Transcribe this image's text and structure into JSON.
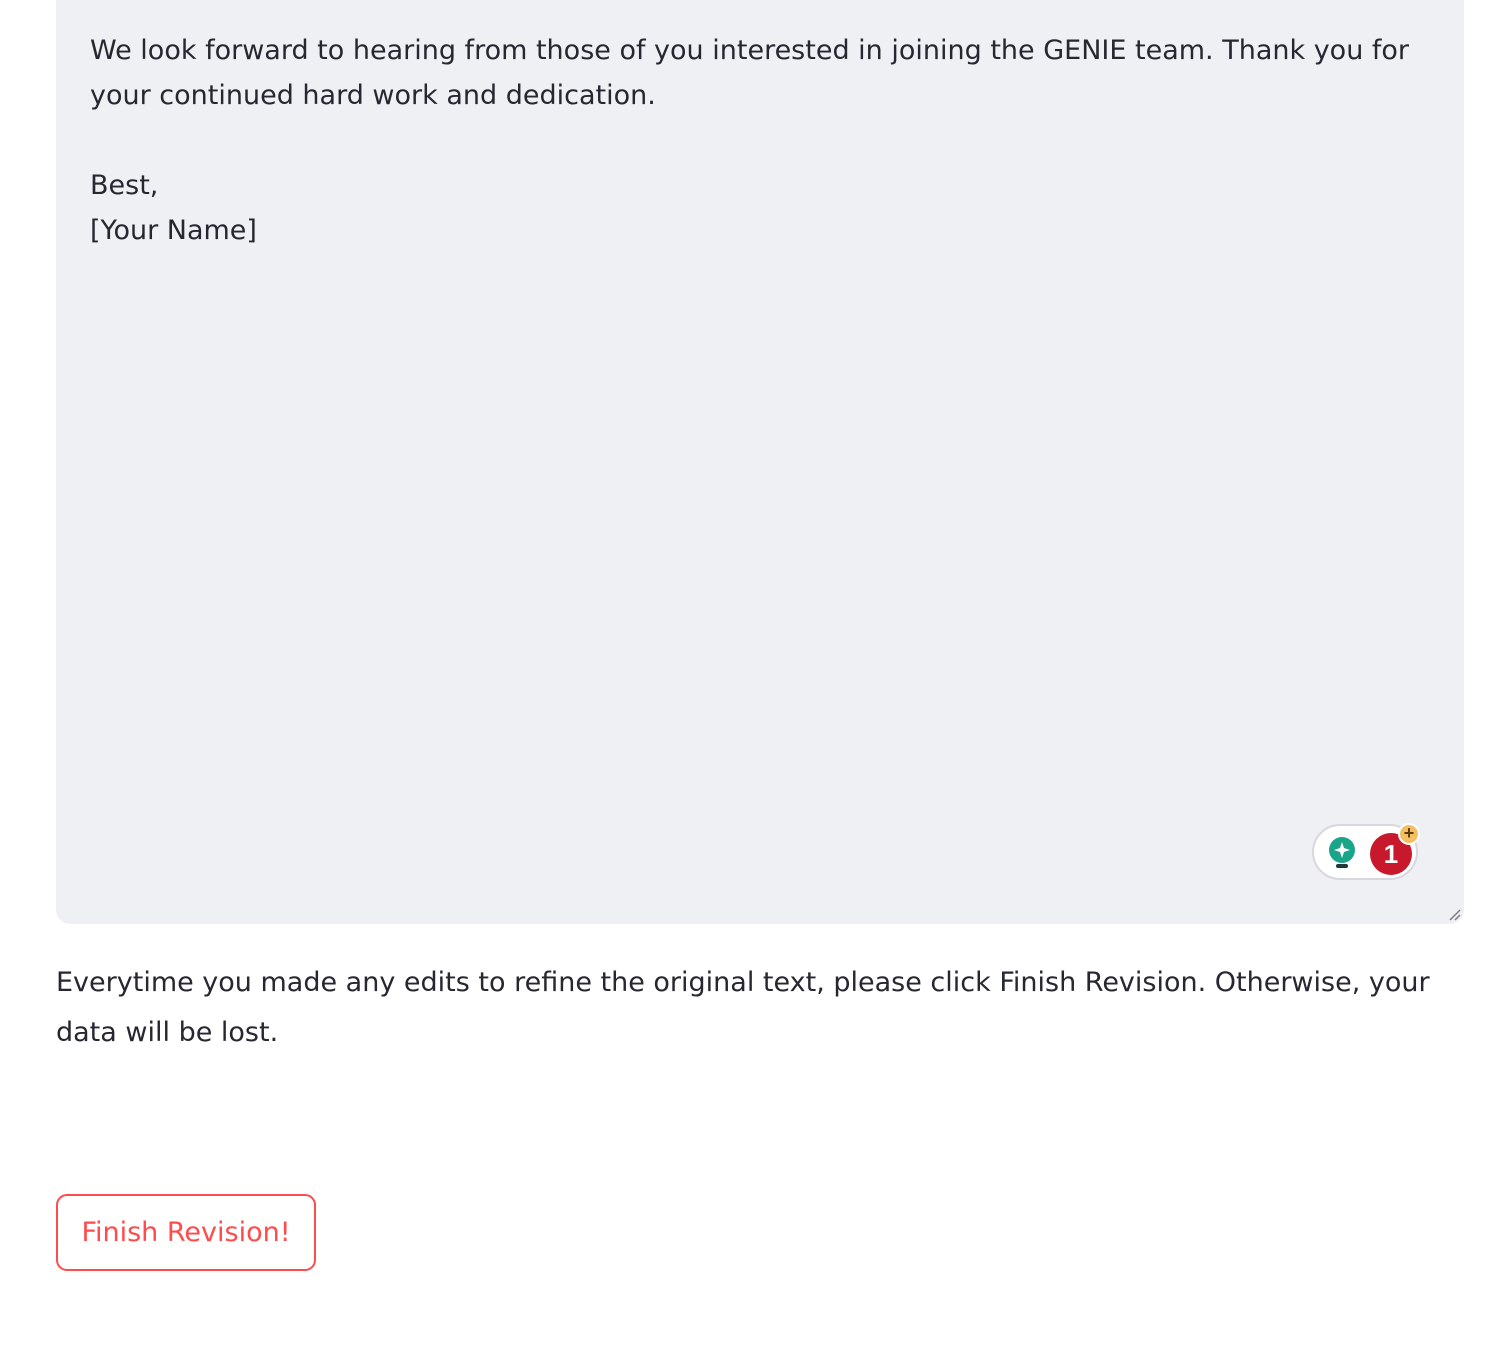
{
  "editor": {
    "lines": [
      "We look forward to hearing from those of you interested in joining the GENIE team. Thank you for",
      "your continued hard work and dedication.",
      "",
      "Best,",
      "[Your Name]"
    ]
  },
  "grammar_widget": {
    "suggestion_count": "1",
    "plus_symbol": "+",
    "icon": "lightbulb-icon"
  },
  "notice": {
    "text": "Everytime you made any edits to refine the original text, please click Finish Revision. Otherwise, your data will be lost."
  },
  "actions": {
    "finish_label": "Finish Revision!"
  },
  "colors": {
    "accent": "#ff4b4b",
    "editor_background": "#eff0f4",
    "badge_red": "#c8182c",
    "bulb_green": "#1aa58a",
    "plus_orange": "#f4bf63"
  }
}
